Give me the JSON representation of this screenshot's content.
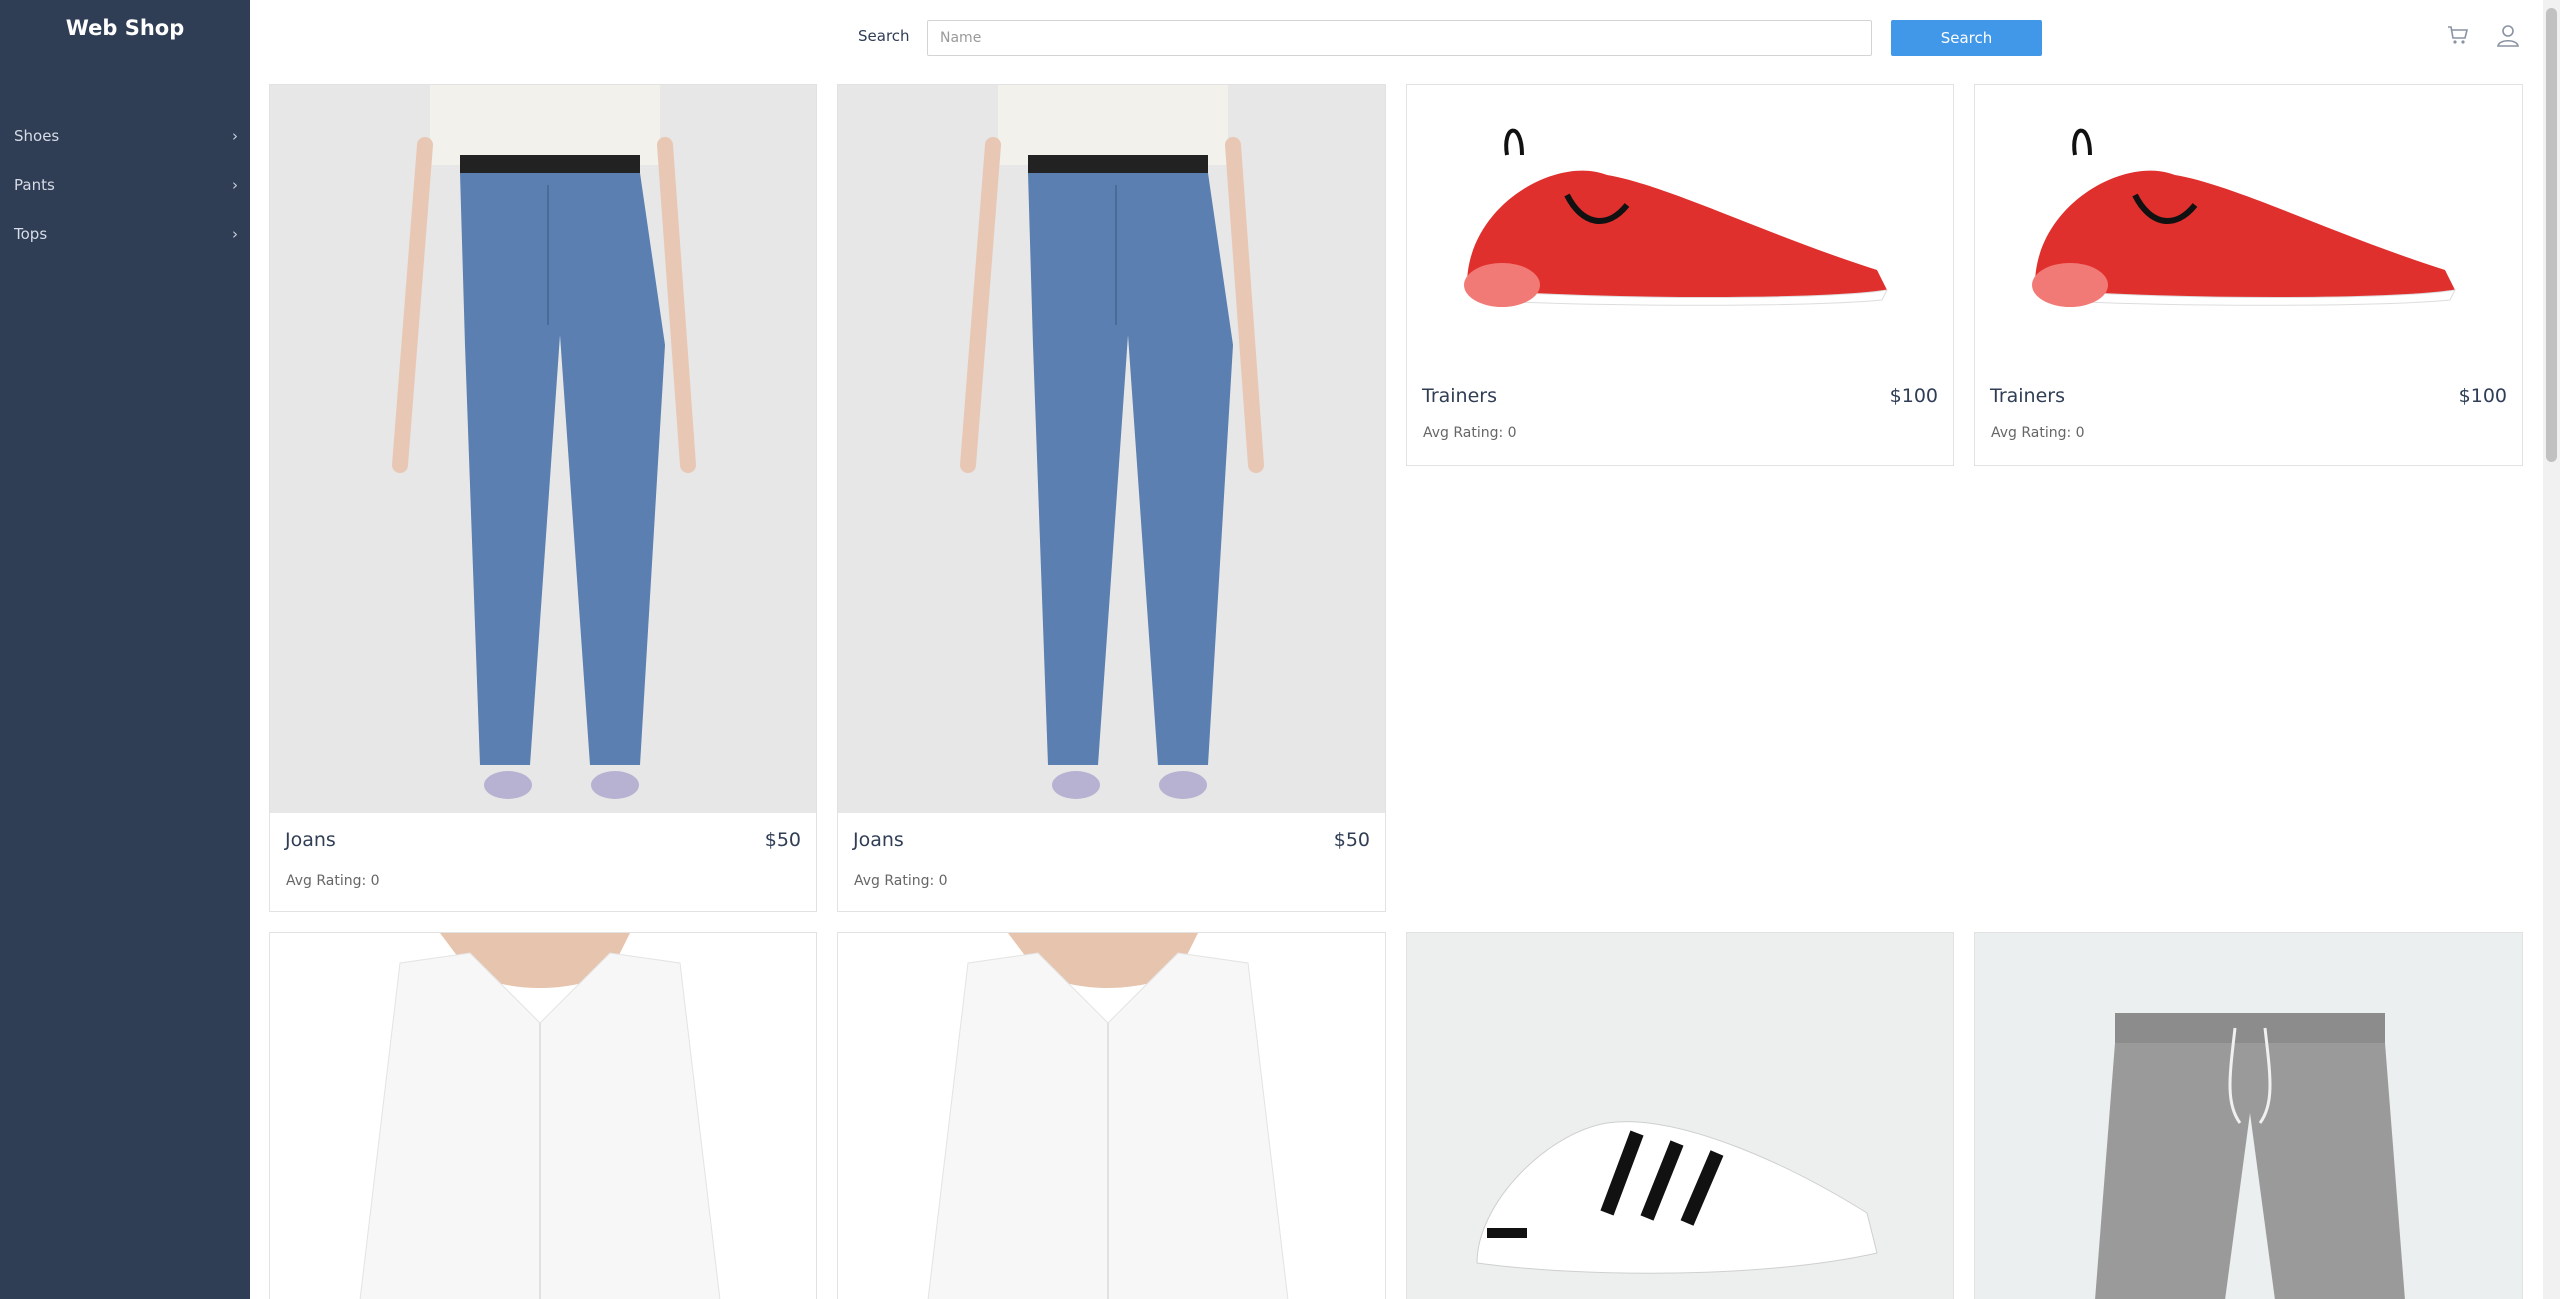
{
  "brand": "Web Shop",
  "sidebar": {
    "items": [
      {
        "label": "Shoes"
      },
      {
        "label": "Pants"
      },
      {
        "label": "Tops"
      }
    ]
  },
  "search": {
    "label": "Search",
    "placeholder": "Name",
    "value": "",
    "button_label": "Search"
  },
  "header_icons": [
    "cart-icon",
    "user-icon"
  ],
  "products": [
    {
      "name": "Joans",
      "price": "$50",
      "rating": "Avg Rating: 0",
      "image": "jeans-image"
    },
    {
      "name": "Joans",
      "price": "$50",
      "rating": "Avg Rating: 0",
      "image": "jeans-image"
    },
    {
      "name": "Trainers",
      "price": "$100",
      "rating": "Avg Rating: 0",
      "image": "red-sneaker-image"
    },
    {
      "name": "Trainers",
      "price": "$100",
      "rating": "Avg Rating: 0",
      "image": "red-sneaker-image"
    },
    {
      "image": "white-shirt-image"
    },
    {
      "image": "white-shirt-image"
    },
    {
      "image": "white-sneaker-image"
    },
    {
      "image": "grey-sweatpants-image"
    }
  ],
  "colors": {
    "sidebar": "#2f3d55",
    "accent": "#4197e8",
    "sneaker_red": "#e0302e",
    "denim": "#5a7fb0"
  }
}
